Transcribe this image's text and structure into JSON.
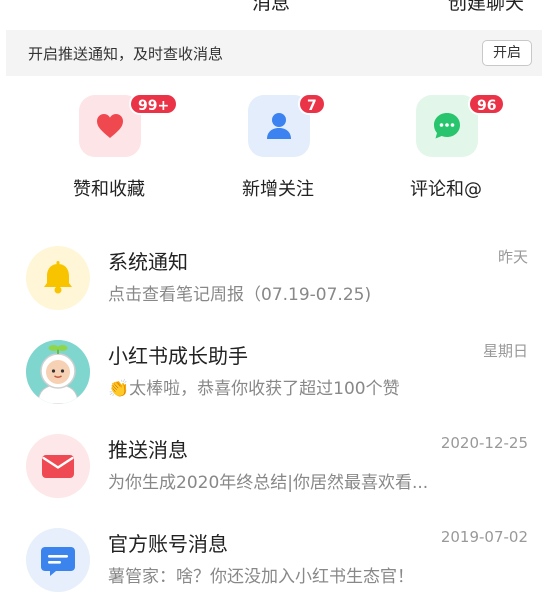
{
  "header": {
    "title": "消息",
    "right_action": "创建聊天"
  },
  "banner": {
    "text": "开启推送通知，及时查收消息",
    "button": "开启"
  },
  "quick_actions": [
    {
      "label": "赞和收藏",
      "badge": "99+",
      "icon": "heart-icon"
    },
    {
      "label": "新增关注",
      "badge": "7",
      "icon": "person-icon"
    },
    {
      "label": "评论和@",
      "badge": "96",
      "icon": "comment-icon"
    }
  ],
  "messages": [
    {
      "title": "系统通知",
      "preview": "点击查看笔记周报（07.19-07.25)",
      "time": "昨天",
      "icon": "bell-icon"
    },
    {
      "title": "小红书成长助手",
      "preview": "👏太棒啦，恭喜你收获了超过100个赞",
      "time": "星期日",
      "icon": "astronaut-avatar"
    },
    {
      "title": "推送消息",
      "preview": "为你生成2020年终总结|你居然最喜欢看...",
      "time": "2020-12-25",
      "icon": "envelope-icon"
    },
    {
      "title": "官方账号消息",
      "preview": "薯管家：啥？你还没加入小红书生态官！",
      "time": "2019-07-02",
      "icon": "chat-box-icon"
    }
  ],
  "colors": {
    "badge": "#ea3347",
    "heart_tile": "#fde4e6",
    "heart": "#f0484f",
    "person_tile": "#e3edfb",
    "person": "#3c82f0",
    "comment_tile": "#e2f6ea",
    "comment": "#29c46e",
    "bell_bg": "#fff6d8",
    "bell": "#f8c400",
    "mail_bg": "#fde7e8",
    "mail": "#ef4a53",
    "official_bg": "#e6effb",
    "official": "#3b84ee"
  }
}
